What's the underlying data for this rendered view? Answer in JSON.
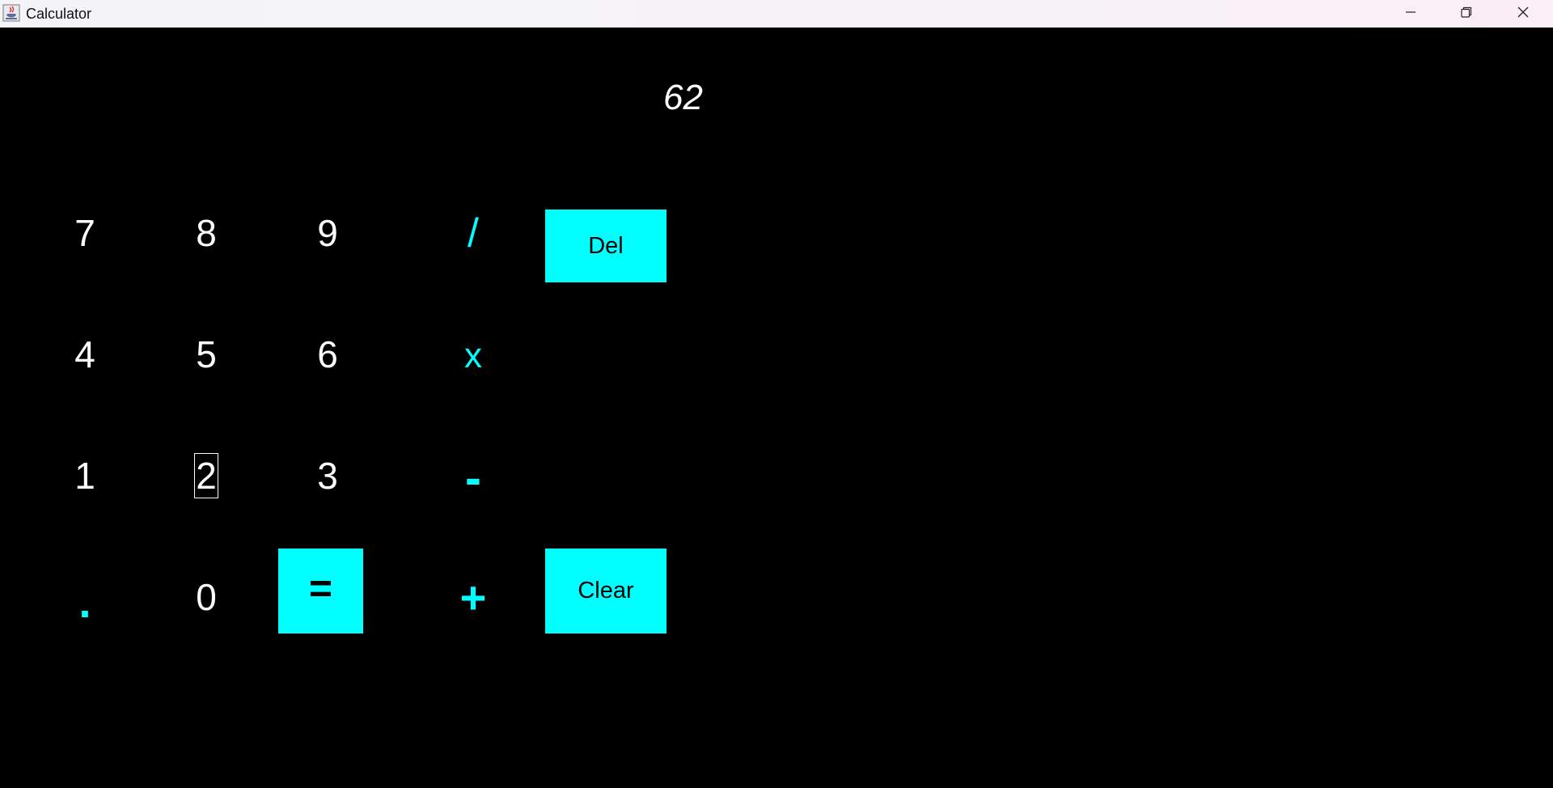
{
  "window": {
    "title": "Calculator",
    "app_icon": "java-cup-icon",
    "controls": {
      "minimize_icon": "minimize-icon",
      "maximize_icon": "restore-icon",
      "close_icon": "close-icon"
    }
  },
  "display": {
    "value": "62"
  },
  "keys": {
    "seven": "7",
    "eight": "8",
    "nine": "9",
    "four": "4",
    "five": "5",
    "six": "6",
    "one": "1",
    "two": "2",
    "three": "3",
    "dot": ".",
    "zero": "0",
    "equals": "=",
    "divide": "/",
    "multiply": "x",
    "subtract": "-",
    "add": "+",
    "delete": "Del",
    "clear": "Clear"
  },
  "colors": {
    "background": "#000000",
    "accent": "#00ffff",
    "digit_text": "#ffffff"
  }
}
